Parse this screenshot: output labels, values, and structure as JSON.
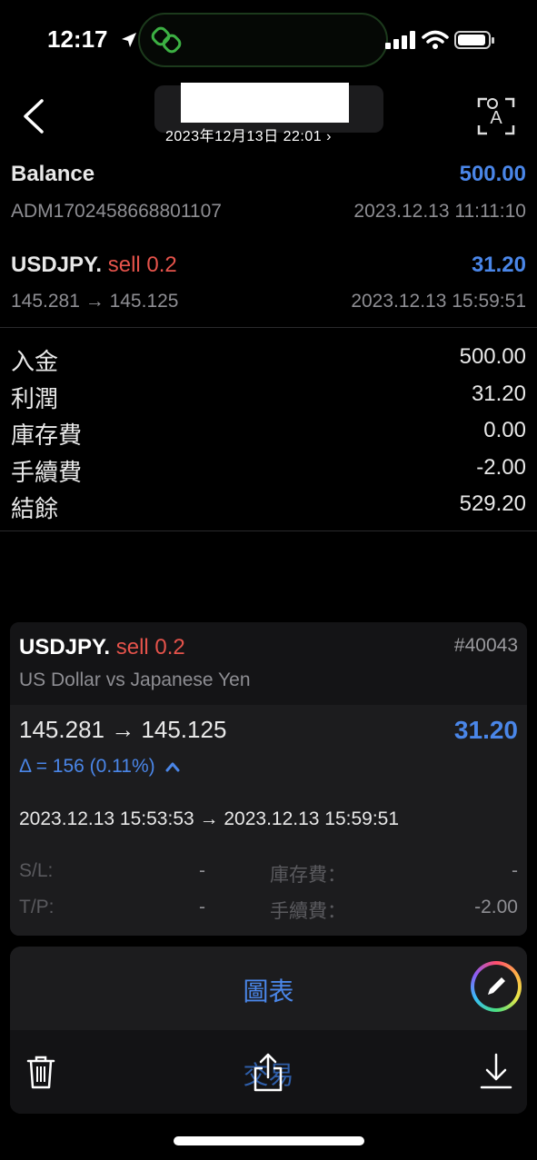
{
  "status_bar": {
    "time": "12:17"
  },
  "header": {
    "date_link": "2023年12月13日 22:01 ›"
  },
  "balance": {
    "label": "Balance",
    "amount": "500.00",
    "account_id": "ADM1702458668801107",
    "timestamp": "2023.12.13 11:11:10"
  },
  "trade_row": {
    "symbol": "USDJPY.",
    "side": "sell 0.2",
    "profit": "31.20",
    "prices": "145.281 → 145.125",
    "timestamp": "2023.12.13 15:59:51"
  },
  "summary": [
    {
      "label": "入金",
      "value": "500.00"
    },
    {
      "label": "利潤",
      "value": "31.20"
    },
    {
      "label": "庫存費",
      "value": "0.00"
    },
    {
      "label": "手續費",
      "value": "-2.00"
    },
    {
      "label": "結餘",
      "value": "529.20"
    }
  ],
  "card": {
    "symbol": "USDJPY.",
    "side": "sell 0.2",
    "ticket": "#40043",
    "name": "US Dollar vs Japanese Yen",
    "prices": "145.281 → 145.125",
    "profit": "31.20",
    "delta": "Δ = 156 (0.11%)",
    "times": "2023.12.13 15:53:53 → 2023.12.13 15:59:51",
    "sl_label": "S/L:",
    "sl_value": "-",
    "tp_label": "T/P:",
    "tp_value": "-",
    "swap_label": "庫存費：",
    "swap_value": "-",
    "commission_label": "手續費：",
    "commission_value": "-2.00"
  },
  "bottom": {
    "chart_tab": "圖表",
    "trade_tab": "交易"
  },
  "colors": {
    "accent_blue": "#4a86e8",
    "sell_red": "#e5534b",
    "background": "#000000"
  }
}
